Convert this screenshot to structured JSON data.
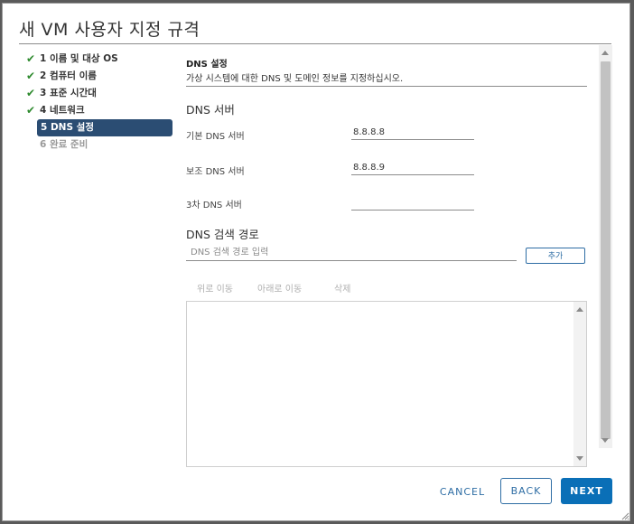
{
  "dialog": {
    "title": "새 VM 사용자 지정 규격"
  },
  "steps": [
    {
      "label": "1 이름 및 대상 OS",
      "state": "done"
    },
    {
      "label": "2 컴퓨터 이름",
      "state": "done"
    },
    {
      "label": "3 표준 시간대",
      "state": "done"
    },
    {
      "label": "4 네트워크",
      "state": "done"
    },
    {
      "label": "5 DNS 설정",
      "state": "active"
    },
    {
      "label": "6 완료 준비",
      "state": "pending"
    }
  ],
  "section": {
    "heading": "DNS 설정",
    "description": "가상 시스템에 대한 DNS 및 도메인 정보를 지정하십시오."
  },
  "dns_servers": {
    "heading": "DNS 서버",
    "primary_label": "기본 DNS 서버",
    "primary_value": "8.8.8.8",
    "secondary_label": "보조 DNS 서버",
    "secondary_value": "8.8.8.9",
    "tertiary_label": "3차 DNS 서버",
    "tertiary_value": ""
  },
  "dns_search": {
    "heading": "DNS 검색 경로",
    "placeholder": "DNS 검색 경로 입력",
    "add_label": "추가",
    "move_up_label": "위로 이동",
    "move_down_label": "아래로 이동",
    "delete_label": "삭제"
  },
  "footer": {
    "cancel_label": "CANCEL",
    "back_label": "BACK",
    "next_label": "NEXT"
  },
  "colors": {
    "accent": "#0a6fb7",
    "active_step": "#2b4d73",
    "check": "#2e8a2e"
  }
}
